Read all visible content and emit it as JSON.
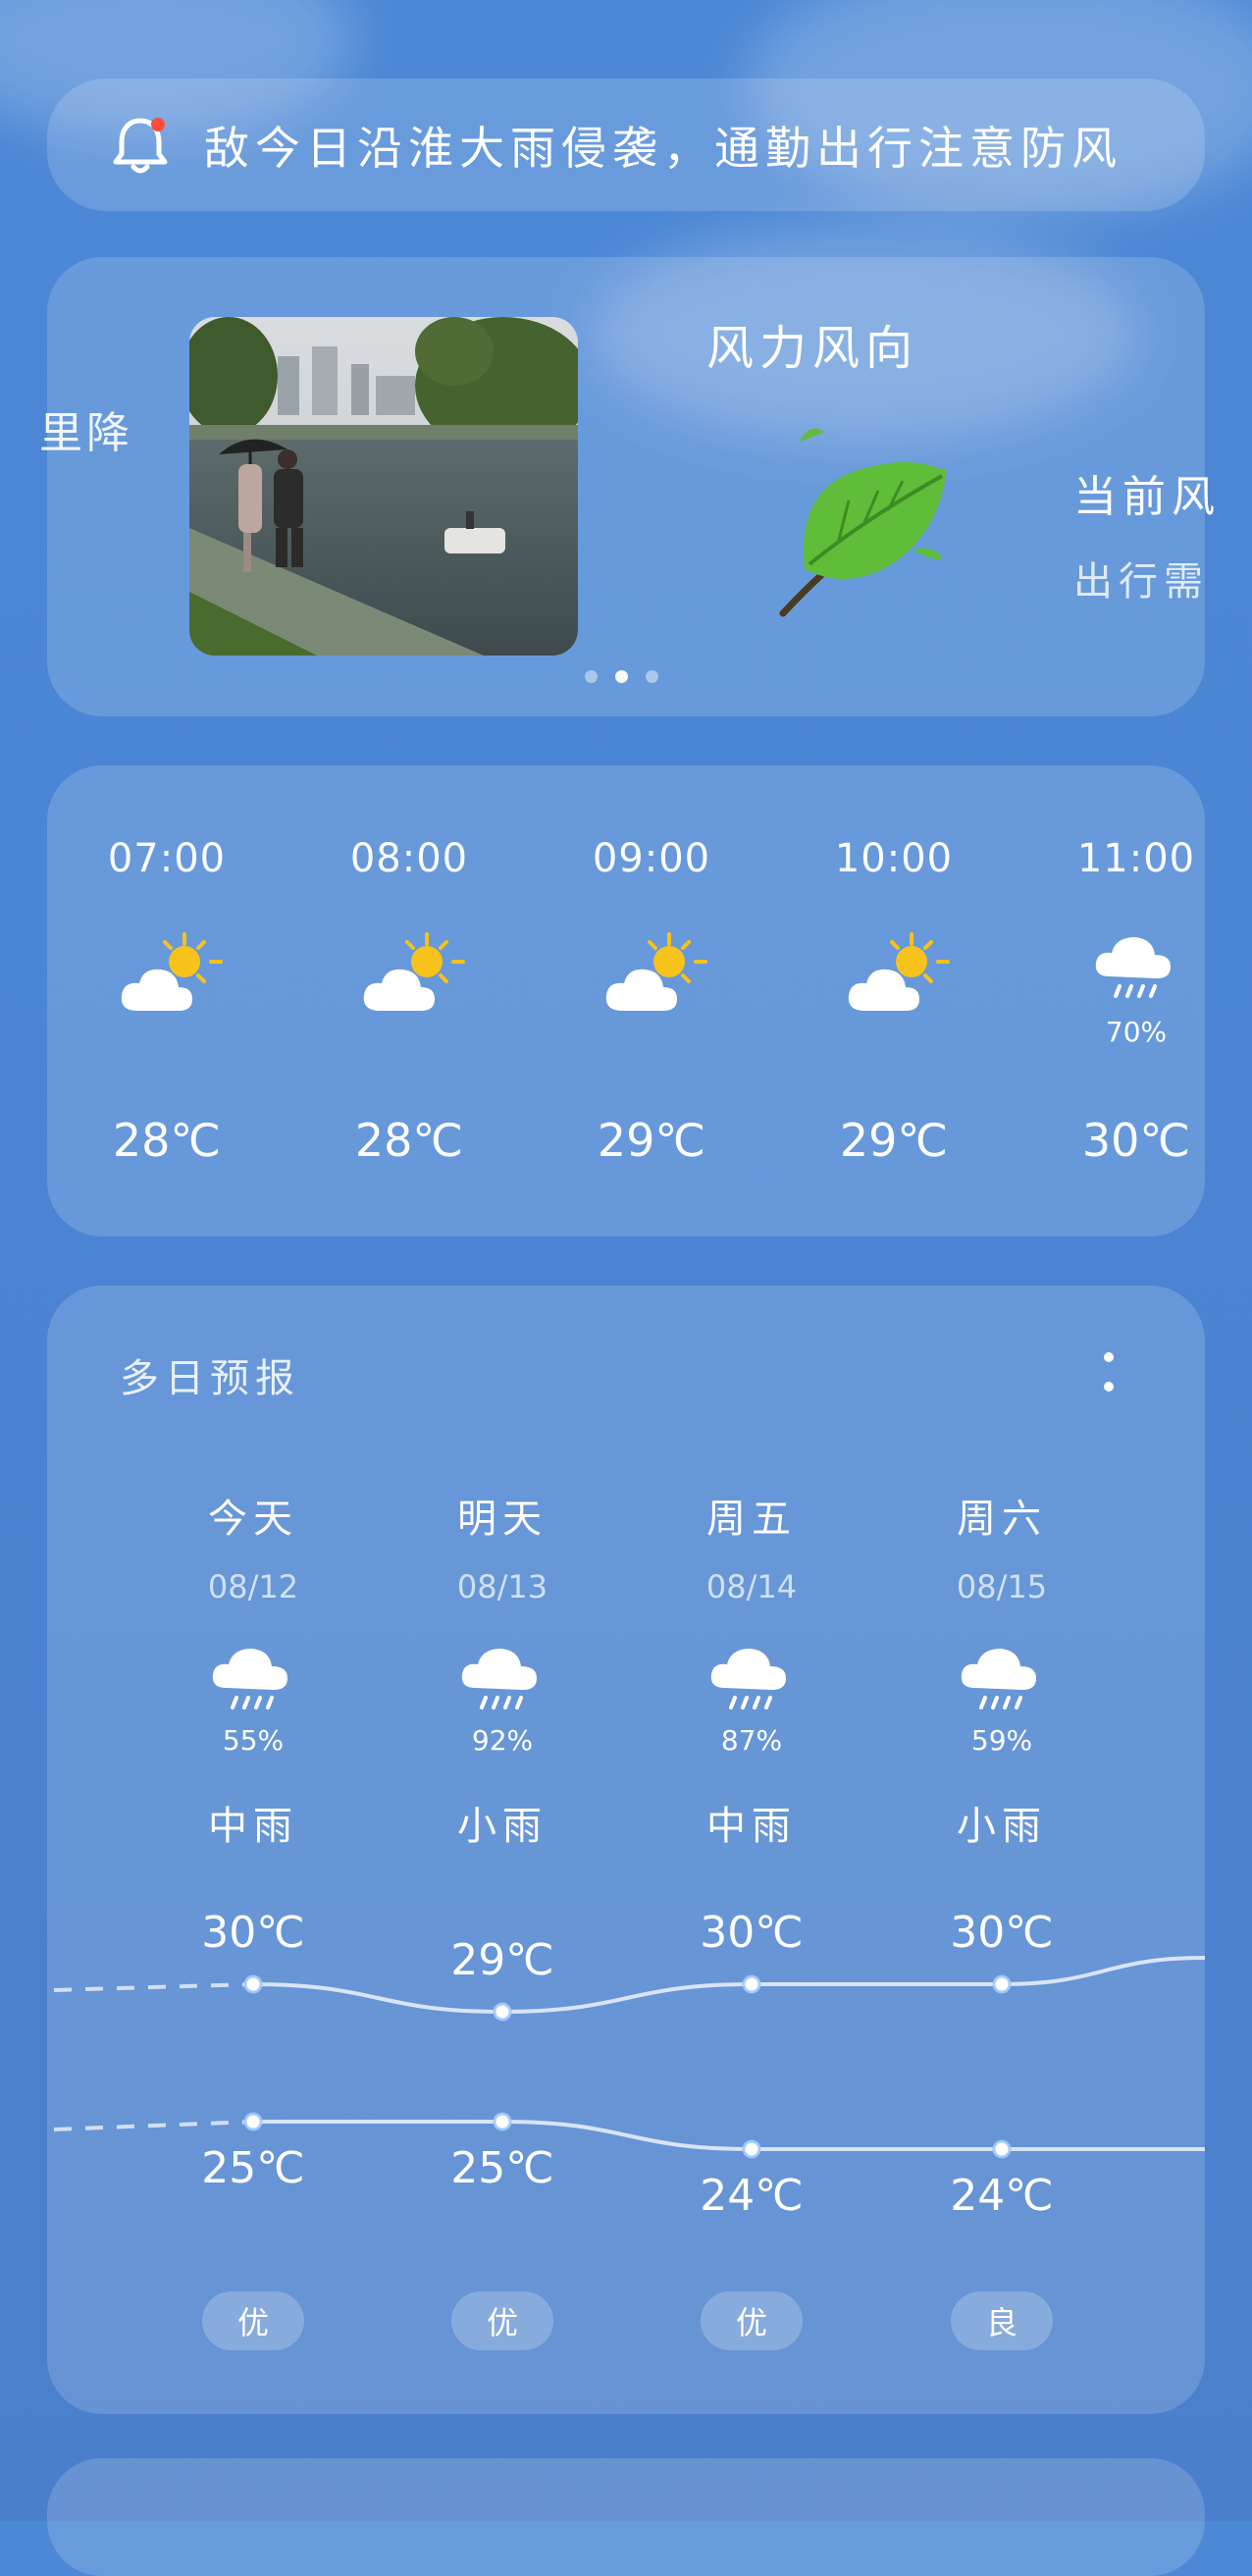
{
  "banner": {
    "icon": "bell-alert-icon",
    "text": "敌今日沿淮大雨侵袭，通勤出行注意防风"
  },
  "carousel": {
    "left_peek_text": "里降",
    "wind_title": "风力风向",
    "wind_icon": "leaf-wind-icon",
    "right_peek_title": "当前风",
    "right_peek_sub": "出行需",
    "photo_icon": "rain-street-photo",
    "pages": 3,
    "active_page": 1
  },
  "hourly": [
    {
      "time": "07:00",
      "icon": "partly-sunny-icon",
      "temp": "28℃",
      "precip": ""
    },
    {
      "time": "08:00",
      "icon": "partly-sunny-icon",
      "temp": "28℃",
      "precip": ""
    },
    {
      "time": "09:00",
      "icon": "partly-sunny-icon",
      "temp": "29℃",
      "precip": ""
    },
    {
      "time": "10:00",
      "icon": "partly-sunny-icon",
      "temp": "29℃",
      "precip": ""
    },
    {
      "time": "11:00",
      "icon": "rain-cloud-icon",
      "temp": "30℃",
      "precip": "70%"
    }
  ],
  "daily": {
    "title": "多日预报",
    "menu_icon": "more-vertical-icon",
    "days": [
      {
        "name": "今天",
        "date": "08/12",
        "icon": "rain-cloud-icon",
        "precip": "55%",
        "cond": "中雨",
        "high": "30℃",
        "low": "25℃",
        "aqi": "优"
      },
      {
        "name": "明天",
        "date": "08/13",
        "icon": "rain-cloud-icon",
        "precip": "92%",
        "cond": "小雨",
        "high": "29℃",
        "low": "25℃",
        "aqi": "优"
      },
      {
        "name": "周五",
        "date": "08/14",
        "icon": "rain-cloud-icon",
        "precip": "87%",
        "cond": "中雨",
        "high": "30℃",
        "low": "24℃",
        "aqi": "优"
      },
      {
        "name": "周六",
        "date": "08/15",
        "icon": "rain-cloud-icon",
        "precip": "59%",
        "cond": "小雨",
        "high": "30℃",
        "low": "24℃",
        "aqi": "良"
      }
    ]
  },
  "colors": {
    "background": "#4b86d4",
    "card": "rgba(255,255,255,0.16)",
    "sun": "#f7c21b",
    "alert_dot": "#ff4d3a",
    "leaf": "#5fbd3a"
  }
}
